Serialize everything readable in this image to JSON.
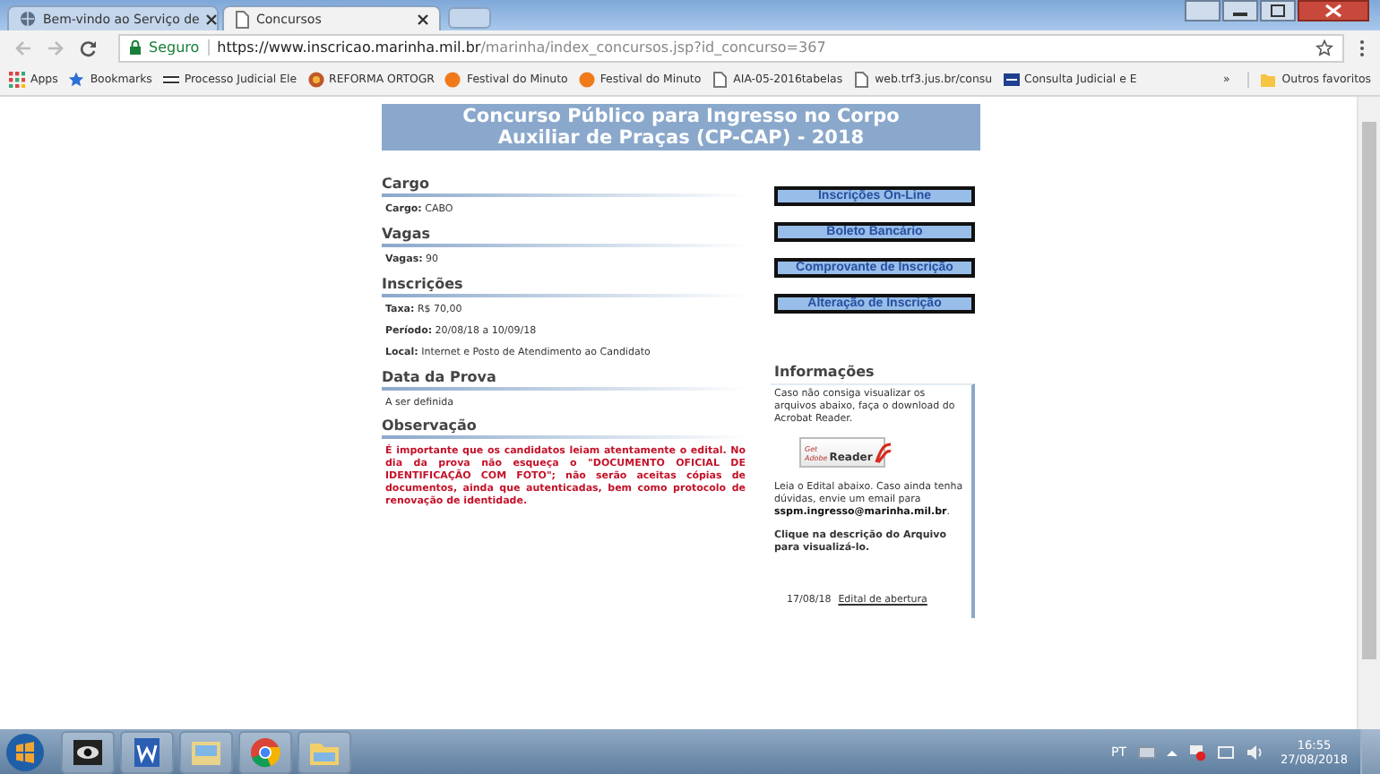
{
  "browser": {
    "tabs": [
      {
        "title": "Bem-vindo ao Serviço de",
        "selected": false
      },
      {
        "title": "Concursos",
        "selected": true
      }
    ],
    "address": {
      "secure_label": "Seguro",
      "host": "https://www.inscricao.marinha.mil.br",
      "path": "/marinha/index_concursos.jsp?id_concurso=367"
    },
    "bookmarks": [
      {
        "kind": "apps",
        "label": "Apps"
      },
      {
        "kind": "star",
        "label": "Bookmarks"
      },
      {
        "kind": "pje",
        "label": "Processo Judicial Ele"
      },
      {
        "kind": "globe",
        "label": "REFORMA ORTOGR"
      },
      {
        "kind": "dot",
        "label": "Festival do Minuto"
      },
      {
        "kind": "dot",
        "label": "Festival do Minuto"
      },
      {
        "kind": "page",
        "label": "AIA-05-2016tabelas"
      },
      {
        "kind": "page",
        "label": "web.trf3.jus.br/consu"
      },
      {
        "kind": "trf",
        "label": "Consulta Judicial e E"
      }
    ],
    "more": "»",
    "other": "Outros favoritos"
  },
  "page": {
    "title": [
      "Concurso Público para Ingresso no Corpo",
      "Auxiliar de Praças (CP-CAP) - 2018"
    ],
    "sections": [
      {
        "heading": "Cargo",
        "kind": "fields",
        "fields": [
          {
            "label": "Cargo:",
            "value": "CABO"
          }
        ]
      },
      {
        "heading": "Vagas",
        "kind": "fields",
        "fields": [
          {
            "label": "Vagas:",
            "value": "90"
          }
        ]
      },
      {
        "heading": "Inscrições",
        "kind": "fields",
        "fields": [
          {
            "label": "Taxa:",
            "value": "R$ 70,00"
          },
          {
            "label": "Período:",
            "value": "20/08/18 a 10/09/18"
          },
          {
            "label": "Local:",
            "value": "Internet e Posto de Atendimento ao Candidato"
          }
        ]
      },
      {
        "heading": "Data da Prova",
        "kind": "text",
        "text": "A ser definida"
      },
      {
        "heading": "Observação",
        "kind": "notice",
        "text": "É importante que os candidatos leiam atentamente o edital. No dia da prova não esqueça o \"DOCUMENTO OFICIAL DE IDENTIFICAÇÃO COM FOTO\"; não serão aceitas cópias de documentos, ainda que autenticadas, bem como protocolo de renovação de identidade."
      }
    ],
    "buttons": [
      "Inscrições On-Line",
      "Boleto Bancário",
      "Comprovante de Inscrição",
      "Alteração de Inscrição"
    ],
    "info": {
      "heading": "Informações",
      "intro": "Caso não consiga visualizar os arquivos abaixo, faça o download do Acrobat Reader.",
      "badge": {
        "small": "Get Adobe",
        "big": "Reader"
      },
      "contact": "Leia o Edital abaixo. Caso ainda tenha dúvidas, envie um email para **sspm.ingresso@marinha.mil.br**.",
      "hint": "Clique na descrição do Arquivo para visualizá-lo.",
      "files": [
        {
          "date": "17/08/18",
          "link": "Edital de abertura"
        }
      ]
    }
  },
  "taskbar": {
    "language": "PT",
    "time": "16:55",
    "date": "27/08/2018"
  }
}
